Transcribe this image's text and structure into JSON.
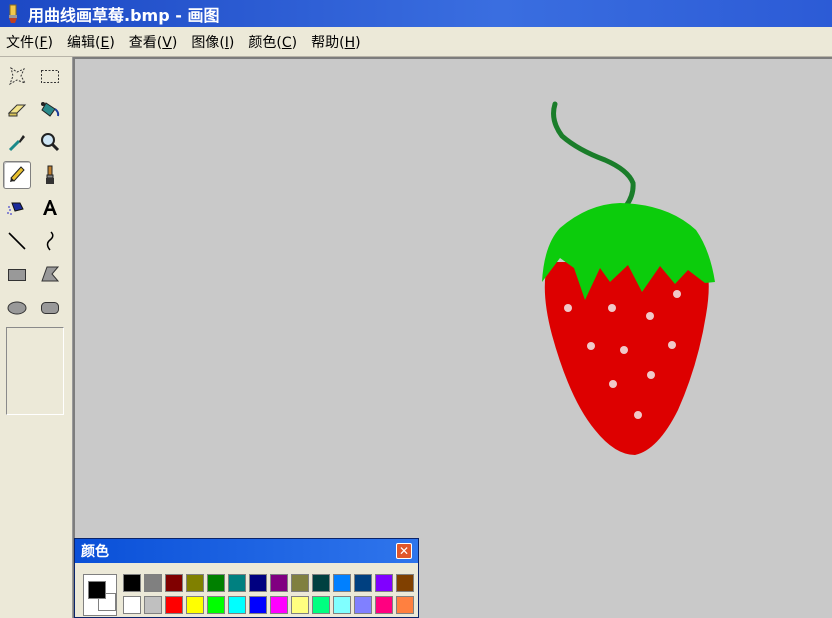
{
  "window": {
    "title": "用曲线画草莓.bmp - 画图"
  },
  "menu": [
    {
      "label": "文件",
      "key": "F"
    },
    {
      "label": "编辑",
      "key": "E"
    },
    {
      "label": "查看",
      "key": "V"
    },
    {
      "label": "图像",
      "key": "I"
    },
    {
      "label": "颜色",
      "key": "C"
    },
    {
      "label": "帮助",
      "key": "H"
    }
  ],
  "toolbox": {
    "selected_tool": "pencil",
    "tools": [
      "free-select",
      "rect-select",
      "eraser",
      "fill",
      "color-picker",
      "magnifier",
      "pencil",
      "brush",
      "airbrush",
      "text",
      "line",
      "curve",
      "rectangle",
      "polygon",
      "ellipse",
      "rounded-rectangle"
    ]
  },
  "canvas": {
    "background_color": "#c9c9c9",
    "strawberry": {
      "stem_color": "#1a7d2a",
      "leaves_color": "#0ccc0c",
      "body_color": "#dd0000",
      "seed_color": "#f0c8c8"
    }
  },
  "palette": {
    "title": "颜色",
    "close": "✕",
    "foreground": "#000000",
    "background": "#ffffff",
    "row1": [
      "#000000",
      "#808080",
      "#800000",
      "#808000",
      "#008000",
      "#008080",
      "#000080",
      "#800080",
      "#808040",
      "#004040",
      "#0080ff",
      "#004080",
      "#8000ff",
      "#804000"
    ],
    "row2": [
      "#ffffff",
      "#c0c0c0",
      "#ff0000",
      "#ffff00",
      "#00ff00",
      "#00ffff",
      "#0000ff",
      "#ff00ff",
      "#ffff80",
      "#00ff80",
      "#80ffff",
      "#8080ff",
      "#ff0080",
      "#ff8040"
    ]
  }
}
